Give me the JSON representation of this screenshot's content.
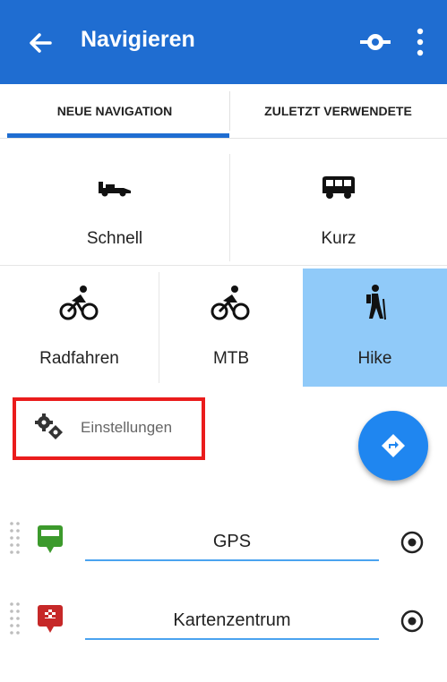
{
  "app_bar": {
    "title": "Navigieren",
    "back_icon": "arrow-left-icon",
    "navigation_icon": "route-marker-icon",
    "menu_icon": "more-vertical-icon",
    "background": "#1f6dd1"
  },
  "tabs": [
    {
      "label": "NEUE NAVIGATION",
      "active": true
    },
    {
      "label": "ZULETZT VERWENDETE",
      "active": false
    }
  ],
  "modes": {
    "row1": [
      {
        "label": "Schnell",
        "icon": "race-car-icon"
      },
      {
        "label": "Kurz",
        "icon": "bus-icon"
      }
    ],
    "row2": [
      {
        "label": "Radfahren",
        "icon": "cyclist-icon"
      },
      {
        "label": "MTB",
        "icon": "mountain-biker-icon"
      },
      {
        "label": "Hike",
        "icon": "hiker-icon",
        "selected": true
      }
    ],
    "selected_color": "#90caf9"
  },
  "settings": {
    "label": "Einstellungen",
    "icon": "settings-gears-icon",
    "highlight_color": "#ea1c1c"
  },
  "fab": {
    "icon": "directions-icon",
    "color": "#1f86f0"
  },
  "waypoints": [
    {
      "value": "GPS",
      "icon": "start-flag-icon",
      "icon_color": "#3c9a2c"
    },
    {
      "value": "Kartenzentrum",
      "icon": "finish-flag-icon",
      "icon_color": "#c62828"
    }
  ]
}
